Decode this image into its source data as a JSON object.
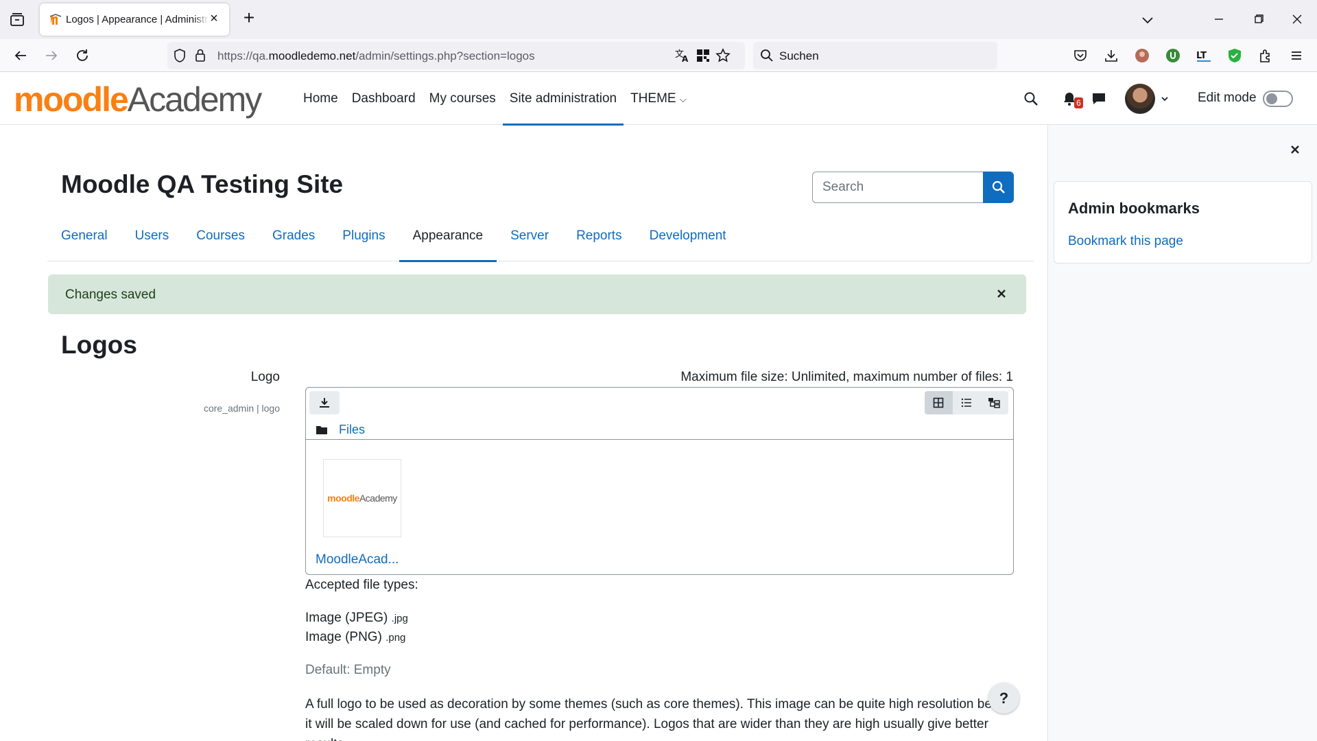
{
  "browser": {
    "tab_title": "Logos | Appearance | Administration",
    "url_prefix": "https://qa.",
    "url_domain": "moodledemo.net",
    "url_path": "/admin/settings.php?section=logos",
    "search_placeholder": "Suchen"
  },
  "header": {
    "logo_moodle": "moodle",
    "logo_academy": "Academy",
    "nav": [
      "Home",
      "Dashboard",
      "My courses",
      "Site administration",
      "THEME"
    ],
    "notification_count": "6",
    "edit_mode_label": "Edit mode"
  },
  "page": {
    "title": "Moodle QA Testing Site",
    "search_placeholder": "Search",
    "tabs": [
      "General",
      "Users",
      "Courses",
      "Grades",
      "Plugins",
      "Appearance",
      "Server",
      "Reports",
      "Development"
    ],
    "active_tab": "Appearance",
    "alert": "Changes saved",
    "section_heading": "Logos"
  },
  "setting": {
    "label": "Logo",
    "id": "core_admin | logo",
    "max_info": "Maximum file size: Unlimited, maximum number of files: 1",
    "path_label": "Files",
    "file_name": "MoodleAcad...",
    "accepted_label": "Accepted file types:",
    "types": [
      {
        "name": "Image (JPEG)",
        "ext": ".jpg"
      },
      {
        "name": "Image (PNG)",
        "ext": ".png"
      }
    ],
    "default": "Default: Empty",
    "description_line1": "A full logo to be used as decoration by some themes (such as core themes). This image can be quite high resolution beca",
    "description_line2": "it will be scaled down for use (and cached for performance). Logos that are wider than they are high usually give better",
    "description_line3": "results."
  },
  "drawer": {
    "title": "Admin bookmarks",
    "link": "Bookmark this page"
  },
  "help_label": "?",
  "colors": {
    "brand": "#f98012",
    "primary": "#0f6cbf",
    "alert_bg": "#d7e6da"
  }
}
